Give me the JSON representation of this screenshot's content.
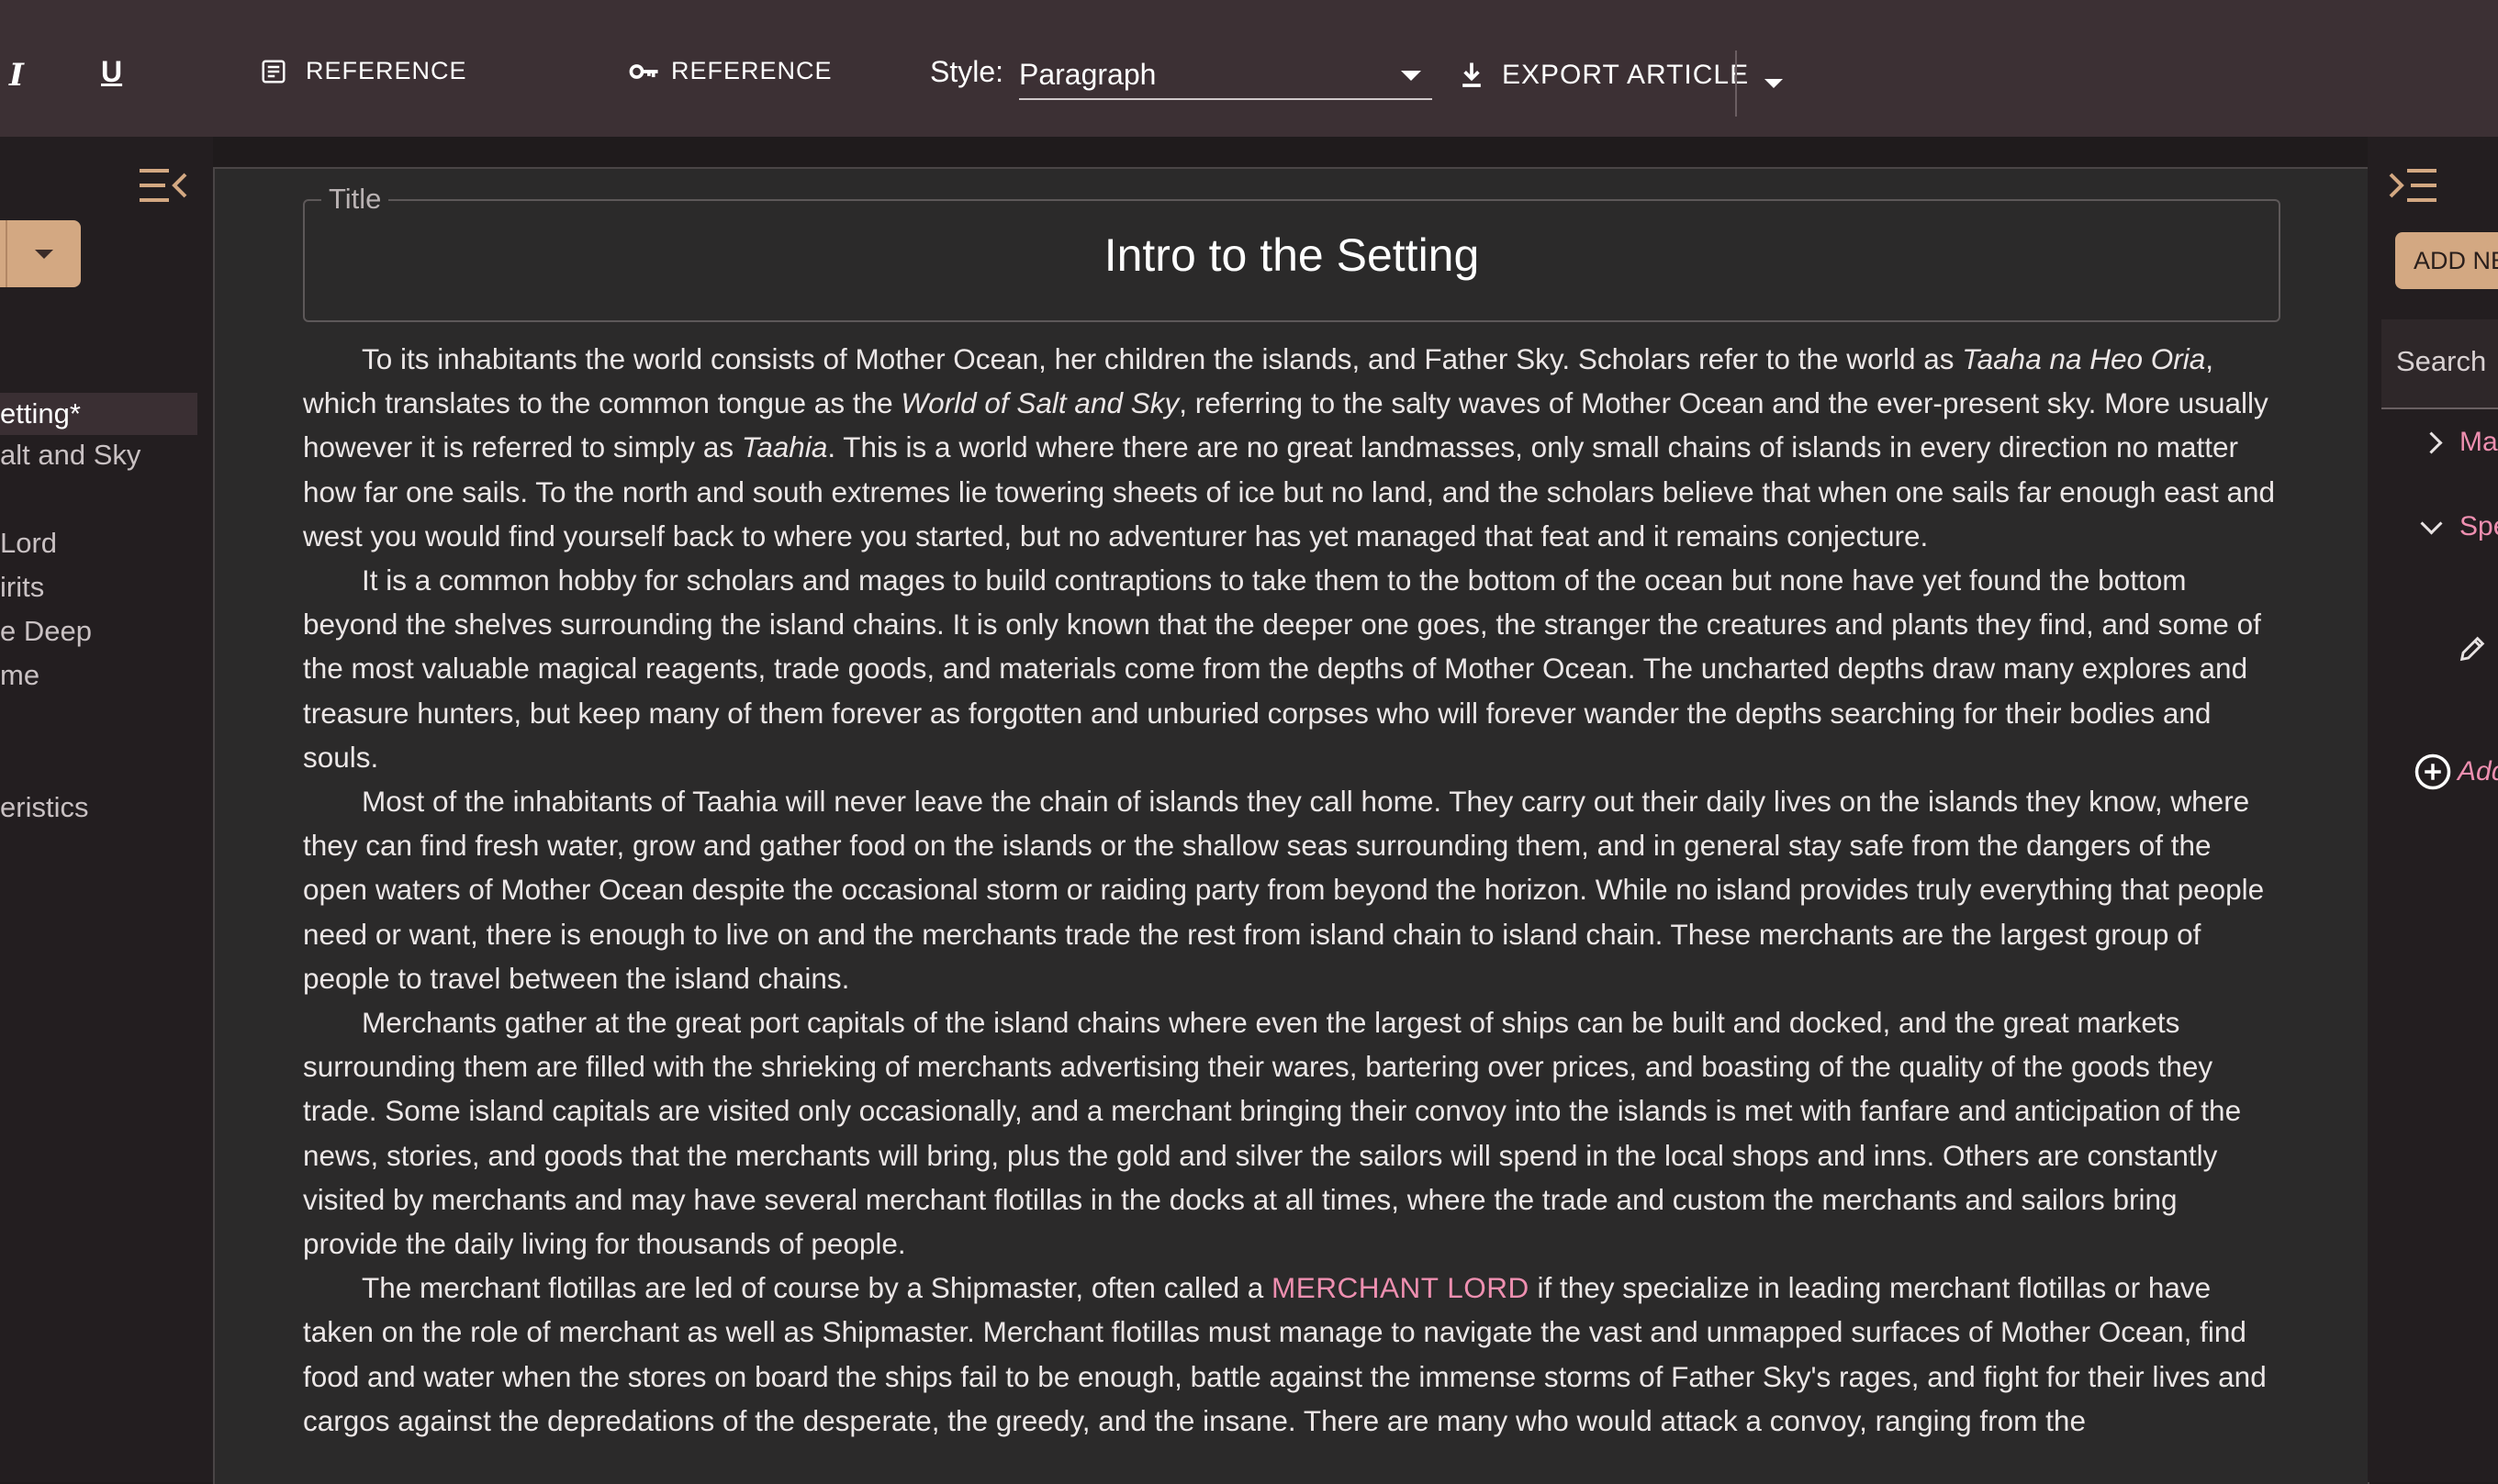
{
  "toolbar": {
    "italic_label": "I",
    "underline_label": "U",
    "reference_1_label": "REFERENCE",
    "reference_2_label": "REFERENCE",
    "style_label": "Style:",
    "style_value": "Paragraph",
    "export_label": "EXPORT ARTICLE"
  },
  "left_sidebar": {
    "items": [
      {
        "label": "etting*",
        "active": true
      },
      {
        "label": "alt and Sky"
      },
      {
        "label": "Lord"
      },
      {
        "label": "irits"
      },
      {
        "label": "e Deep"
      },
      {
        "label": "me"
      },
      {
        "label": "eristics"
      }
    ]
  },
  "editor": {
    "title_legend": "Title",
    "title": "Intro to the Setting",
    "p1": {
      "a": "To its inhabitants the world consists of Mother Ocean, her children the islands, and Father Sky. Scholars refer to the world as ",
      "b": "Taaha na Heo Oria",
      "c": ", which translates to the common tongue as the ",
      "d": "World of Salt and Sky",
      "e": ", referring to the salty waves of Mother Ocean and the ever-present sky. More usually however it is referred to simply as ",
      "f": "Taahia",
      "g": ". This is a world where there are no great landmasses, only small chains of islands in every direction no matter how far one sails. To the north and south extremes lie towering sheets of ice but no land, and the scholars believe that when one sails far enough east and west you would find yourself back to where you started, but no adventurer has yet managed that feat and it remains conjecture."
    },
    "p2": "It is a common hobby for scholars and mages to build contraptions to take them to the bottom of the ocean but none have yet found the bottom beyond the shelves surrounding the island chains. It is only known that the deeper one goes, the stranger the creatures and plants they find, and some of the most valuable magical reagents, trade goods, and materials come from the depths of Mother Ocean. The uncharted depths draw many explores and treasure hunters, but keep many of them forever as forgotten and unburied corpses who will forever wander the depths searching for their bodies and souls.",
    "p3": "Most of the inhabitants of Taahia will never leave the chain of islands they call home. They carry out their daily lives on the islands they know, where they can find fresh water, grow and gather food on the islands or the shallow seas surrounding them, and in general stay safe from the dangers of the open waters of Mother Ocean despite the occasional storm or raiding party from beyond the horizon. While no island provides truly everything that people need or want, there is enough to live on and the merchants trade the rest from island chain to island chain. These merchants are the largest group of people to travel between the island chains.",
    "p4": "Merchants gather at the great port capitals of the island chains where even the largest of ships can be built and docked, and the great markets surrounding them are filled with the shrieking of merchants advertising their wares, bartering over prices, and boasting of the quality of the goods they trade. Some island capitals are visited only occasionally, and a merchant bringing their convoy into the islands is met with fanfare and anticipation of the news, stories, and goods that the merchants will bring, plus the gold and silver the sailors will spend in the local shops and inns. Others are constantly visited by merchants and may have several merchant flotillas in the docks at all times, where the trade and custom the merchants and sailors bring provide the daily living for thousands of people.",
    "p5": {
      "a": "The merchant flotillas are led of course by a Shipmaster, often called a ",
      "link": "MERCHANT LORD",
      "b": " if they specialize in leading merchant flotillas or have taken on the role of merchant as well as Shipmaster. Merchant flotillas must manage to navigate the vast and unmapped surfaces of Mother Ocean, find food and water when the stores on board the ships fail to be enough, battle against the immense storms of Father Sky's rages, and fight for their lives and cargos against the depredations of the desperate, the greedy, and the insane. There are many who would attack a convoy, ranging from the"
    }
  },
  "right_panel": {
    "add_new_label": "ADD NE",
    "search_placeholder": "Search",
    "tree": [
      {
        "label": "Mag",
        "expanded": false
      },
      {
        "label": "Spe",
        "expanded": true
      }
    ],
    "add_label": "Add"
  },
  "colors": {
    "toolbar_bg": "#3c3034",
    "accent": "#d3a882",
    "link": "#ee8fb0",
    "editor_bg": "#2b2a2a"
  },
  "icons": [
    "italic-icon",
    "underline-icon",
    "document-reference-icon",
    "key-reference-icon",
    "download-icon",
    "collapse-left-icon",
    "collapse-right-icon",
    "pencil-icon",
    "add-circle-icon"
  ]
}
